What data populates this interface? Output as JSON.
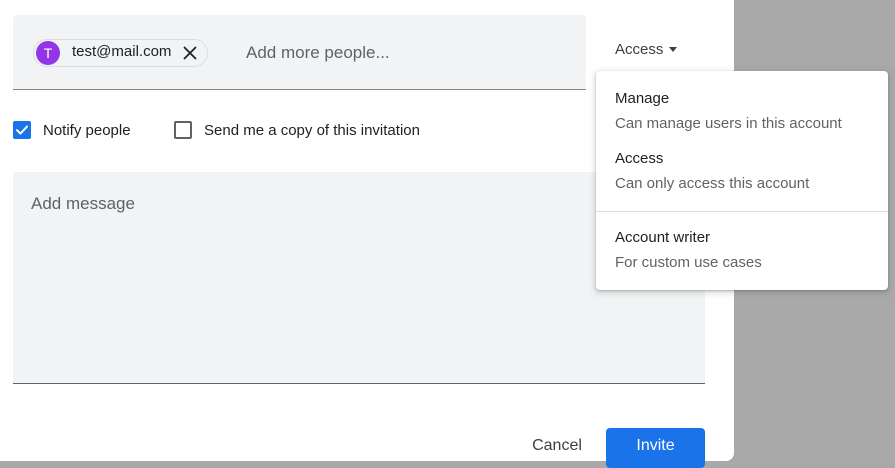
{
  "invite": {
    "chip": {
      "initial": "T",
      "email": "test@mail.com",
      "avatar_color": "#9334e6",
      "remove_icon": "close-icon"
    },
    "people_placeholder": "Add more people...",
    "role_label": "Access",
    "notify_label": "Notify people",
    "notify_checked": true,
    "copy_label": "Send me a copy of this invitation",
    "copy_checked": false,
    "message_placeholder": "Add message",
    "cancel_label": "Cancel",
    "invite_label": "Invite"
  },
  "role_menu": {
    "items": [
      {
        "title": "Manage",
        "description": "Can manage users in this account"
      },
      {
        "title": "Access",
        "description": "Can only access this account"
      },
      {
        "title": "Account writer",
        "description": "For custom use cases"
      }
    ]
  },
  "colors": {
    "accent": "#1a73e8",
    "field_bg": "#f1f3f4",
    "scrim": "#a9a9a9"
  }
}
